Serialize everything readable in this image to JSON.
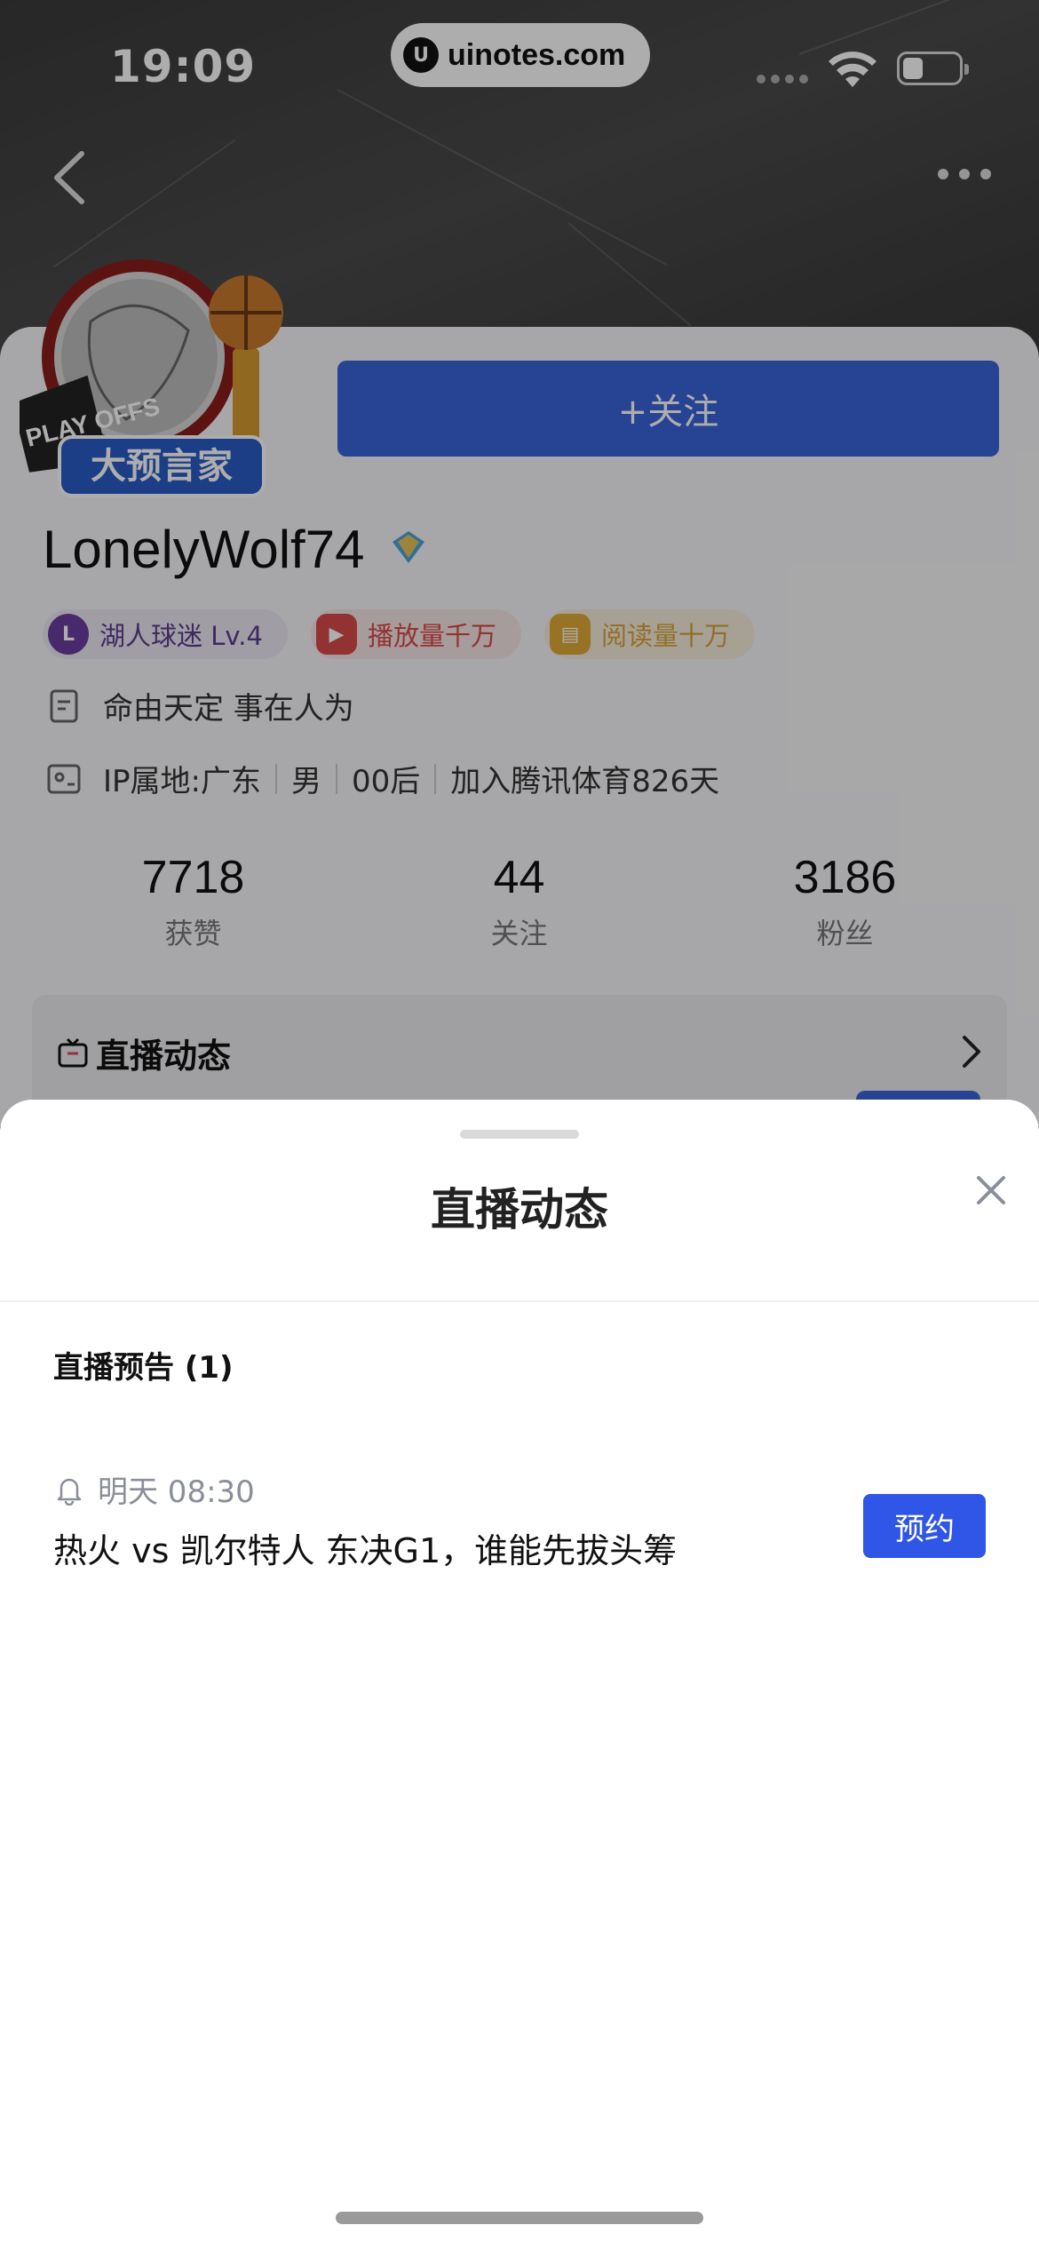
{
  "status_bar": {
    "time": "19:09",
    "url": "uinotes.com"
  },
  "profile": {
    "follow_label": "+关注",
    "username": "LonelyWolf74",
    "badge_text": "大预言家",
    "badge_playoffs": "PLAY OFFS",
    "tags": [
      {
        "label": "湖人球迷 Lv.4",
        "icon": "lakers-icon"
      },
      {
        "label": "播放量千万",
        "icon": "play-icon"
      },
      {
        "label": "阅读量十万",
        "icon": "book-icon"
      }
    ],
    "bio": "命由天定 事在人为",
    "meta": [
      "IP属地:广东",
      "男",
      "00后",
      "加入腾讯体育826天"
    ],
    "stats": [
      {
        "value": "7718",
        "label": "获赞"
      },
      {
        "value": "44",
        "label": "关注"
      },
      {
        "value": "3186",
        "label": "粉丝"
      }
    ],
    "live_section_title": "直播动态"
  },
  "sheet": {
    "title": "直播动态",
    "section_title": "直播预告 (1)",
    "items": [
      {
        "time": "明天 08:30",
        "title": "热火 vs 凯尔特人 东决G1，谁能先拔头筹",
        "action": "预约"
      }
    ]
  },
  "colors": {
    "accent": "#2f56e6",
    "follow": "#3a63d9"
  }
}
